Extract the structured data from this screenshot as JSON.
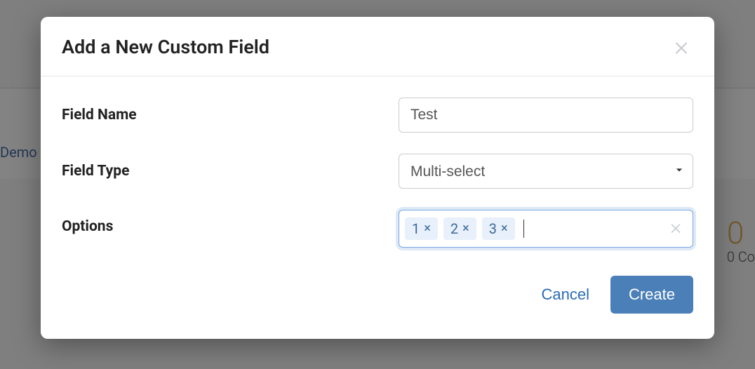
{
  "background": {
    "demo_text": "Demo",
    "stat_number": "0",
    "stat_label": "0 Co"
  },
  "modal": {
    "title": "Add a New Custom Field",
    "fields": {
      "name": {
        "label": "Field Name",
        "value": "Test"
      },
      "type": {
        "label": "Field Type",
        "selected": "Multi-select"
      },
      "options": {
        "label": "Options",
        "tags": [
          "1",
          "2",
          "3"
        ],
        "remove_glyph": "×"
      }
    },
    "footer": {
      "cancel_label": "Cancel",
      "create_label": "Create"
    }
  }
}
